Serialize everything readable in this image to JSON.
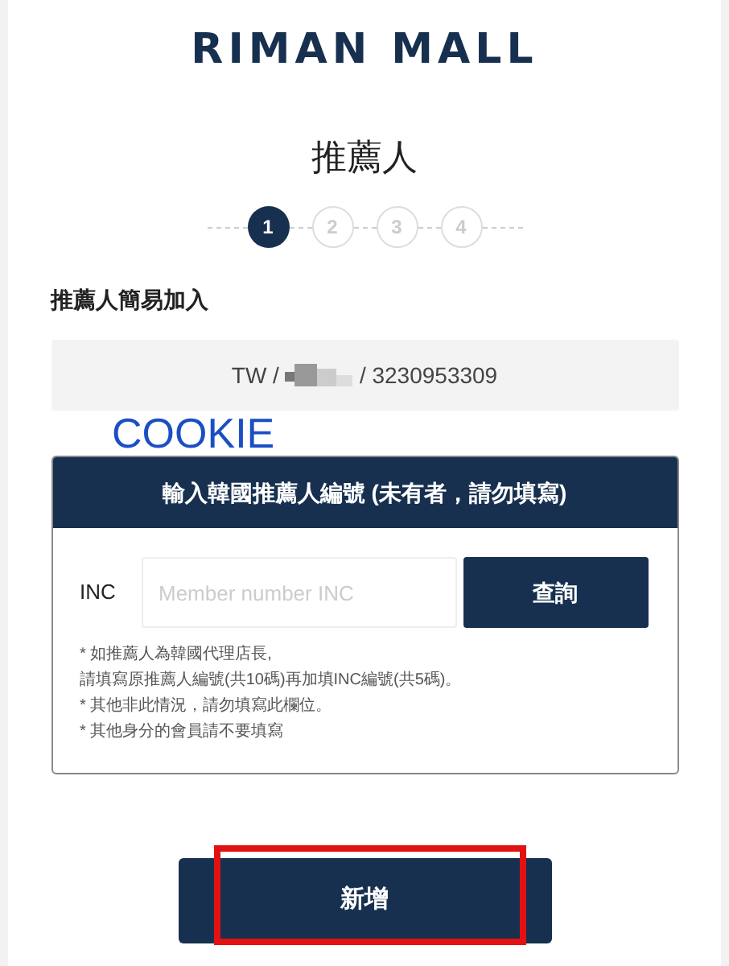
{
  "logo": "RIMAN MALL",
  "title": "推薦人",
  "steps": [
    {
      "label": "1",
      "selected": true
    },
    {
      "label": "2",
      "selected": false
    },
    {
      "label": "3",
      "selected": false
    },
    {
      "label": "4",
      "selected": false
    }
  ],
  "section_label": "推薦人簡易加入",
  "referrer": {
    "prefix": "TW /",
    "suffix": "/ 3230953309"
  },
  "annotation": "COOKIE",
  "panel": {
    "header": "輸入韓國推薦人編號 (未有者，請勿填寫)",
    "field_label": "INC",
    "placeholder": "Member number INC",
    "button": "查詢",
    "notes": [
      "* 如推薦人為韓國代理店長,",
      "請填寫原推薦人編號(共10碼)再加填INC編號(共5碼)。",
      "* 其他非此情況，請勿填寫此欄位。",
      "* 其他身分的會員請不要填寫"
    ]
  },
  "submit": "新增"
}
